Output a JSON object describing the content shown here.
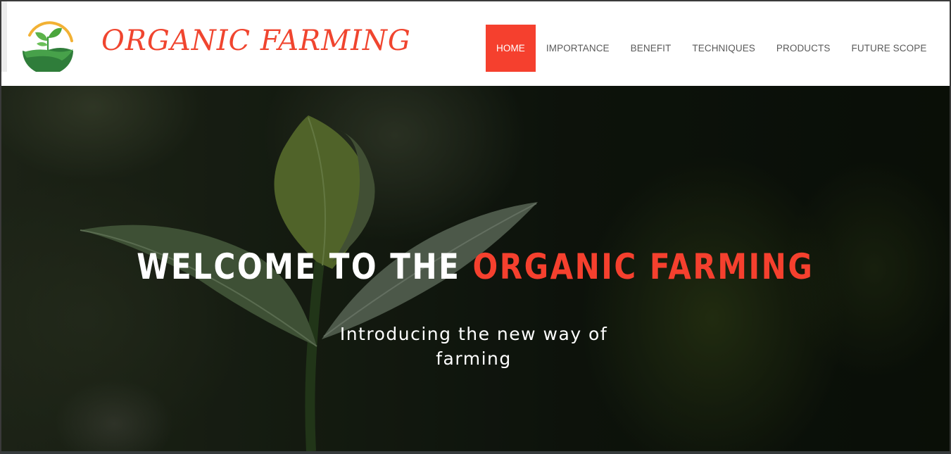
{
  "brand": {
    "name": "ORGANIC FARMING",
    "logo_icon": "leaf-sprout-logo-icon"
  },
  "nav": {
    "items": [
      {
        "label": "HOME",
        "active": true
      },
      {
        "label": "IMPORTANCE",
        "active": false
      },
      {
        "label": "BENEFIT",
        "active": false
      },
      {
        "label": "TECHNIQUES",
        "active": false
      },
      {
        "label": "PRODUCTS",
        "active": false
      },
      {
        "label": "FUTURE SCOPE",
        "active": false
      }
    ]
  },
  "hero": {
    "title_prefix": "WELCOME TO THE",
    "title_highlight": "ORGANIC FARMING",
    "subtitle": "Introducing the new way of farming"
  },
  "colors": {
    "accent": "#f5402e",
    "nav_text": "#5a5a5a",
    "header_bg": "#ffffff"
  }
}
